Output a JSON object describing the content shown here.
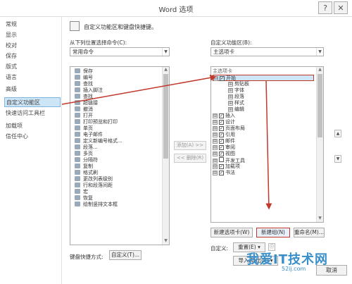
{
  "window": {
    "title": "Word 选项",
    "help": "?",
    "close": "✕"
  },
  "nav": {
    "items": [
      {
        "label": "常规",
        "active": false
      },
      {
        "label": "显示",
        "active": false
      },
      {
        "label": "校对",
        "active": false
      },
      {
        "label": "保存",
        "active": false
      },
      {
        "label": "版式",
        "active": false
      },
      {
        "label": "语言",
        "active": false
      },
      {
        "label": "高级",
        "active": false
      },
      {
        "label": "自定义功能区",
        "active": true
      },
      {
        "label": "快速访问工具栏",
        "active": false
      },
      {
        "label": "加载项",
        "active": false
      },
      {
        "label": "信任中心",
        "active": false
      }
    ]
  },
  "header": {
    "text": "自定义功能区和键盘快捷键。"
  },
  "left_panel": {
    "label": "从下列位置选择命令(C):",
    "combo_value": "常用命令",
    "commands": [
      "保存",
      "编号",
      "查找",
      "插入脚注",
      "查找",
      "超链接",
      "撤消",
      "打开",
      "打印预览和打印",
      "单页",
      "电子邮件",
      "定义新编号格式...",
      "段落...",
      "多页",
      "分隔符",
      "复制",
      "格式刷",
      "更改列表级别",
      "行和段落间距",
      "宏",
      "恢复",
      "绘制竖排文本框"
    ]
  },
  "mid_buttons": {
    "add": "添加(A) >>",
    "remove": "<< 删除(R)"
  },
  "right_panel": {
    "label": "自定义功能区(B):",
    "combo_value": "主选项卡",
    "tree_header": "主选项卡",
    "tree": [
      {
        "label": "开始",
        "level": 0,
        "expand": "⊟",
        "checked": true,
        "selected": true
      },
      {
        "label": "剪贴板",
        "level": 1,
        "expand": "⊞",
        "checked": null,
        "selected": false
      },
      {
        "label": "字体",
        "level": 1,
        "expand": "⊞",
        "checked": null,
        "selected": false
      },
      {
        "label": "段落",
        "level": 1,
        "expand": "⊞",
        "checked": null,
        "selected": false
      },
      {
        "label": "样式",
        "level": 1,
        "expand": "⊞",
        "checked": null,
        "selected": false
      },
      {
        "label": "编辑",
        "level": 1,
        "expand": "⊞",
        "checked": null,
        "selected": false
      },
      {
        "label": "插入",
        "level": 0,
        "expand": "⊞",
        "checked": true,
        "selected": false
      },
      {
        "label": "设计",
        "level": 0,
        "expand": "⊞",
        "checked": true,
        "selected": false
      },
      {
        "label": "页面布局",
        "level": 0,
        "expand": "⊞",
        "checked": true,
        "selected": false
      },
      {
        "label": "引用",
        "level": 0,
        "expand": "⊞",
        "checked": true,
        "selected": false
      },
      {
        "label": "邮件",
        "level": 0,
        "expand": "⊞",
        "checked": true,
        "selected": false
      },
      {
        "label": "审阅",
        "level": 0,
        "expand": "⊞",
        "checked": true,
        "selected": false
      },
      {
        "label": "视图",
        "level": 0,
        "expand": "⊞",
        "checked": true,
        "selected": false
      },
      {
        "label": "开发工具",
        "level": 0,
        "expand": "⊞",
        "checked": false,
        "selected": false
      },
      {
        "label": "加载项",
        "level": 0,
        "expand": "⊞",
        "checked": true,
        "selected": false
      },
      {
        "label": "书法",
        "level": 0,
        "expand": "⊞",
        "checked": true,
        "selected": false
      }
    ],
    "new_tab_btn": "新建选项卡(W)",
    "new_group_btn": "新建组(N)",
    "rename_btn": "重命名(M)...",
    "custom_label": "自定义:",
    "reset_btn": "重置(E) ▾",
    "import_export_btn": "导入/导出(P) ▾"
  },
  "keyboard": {
    "label": "键盘快捷方式:",
    "button": "自定义(T)..."
  },
  "footer": {
    "cancel": "取消"
  },
  "watermark": {
    "main": "我爱IT技术网",
    "url": "52ij.com"
  },
  "colors": {
    "highlight": "#c0392b",
    "selection": "#cde6f7",
    "nav_active_border": "#7fb6e0",
    "watermark": "#3b8fc9"
  }
}
